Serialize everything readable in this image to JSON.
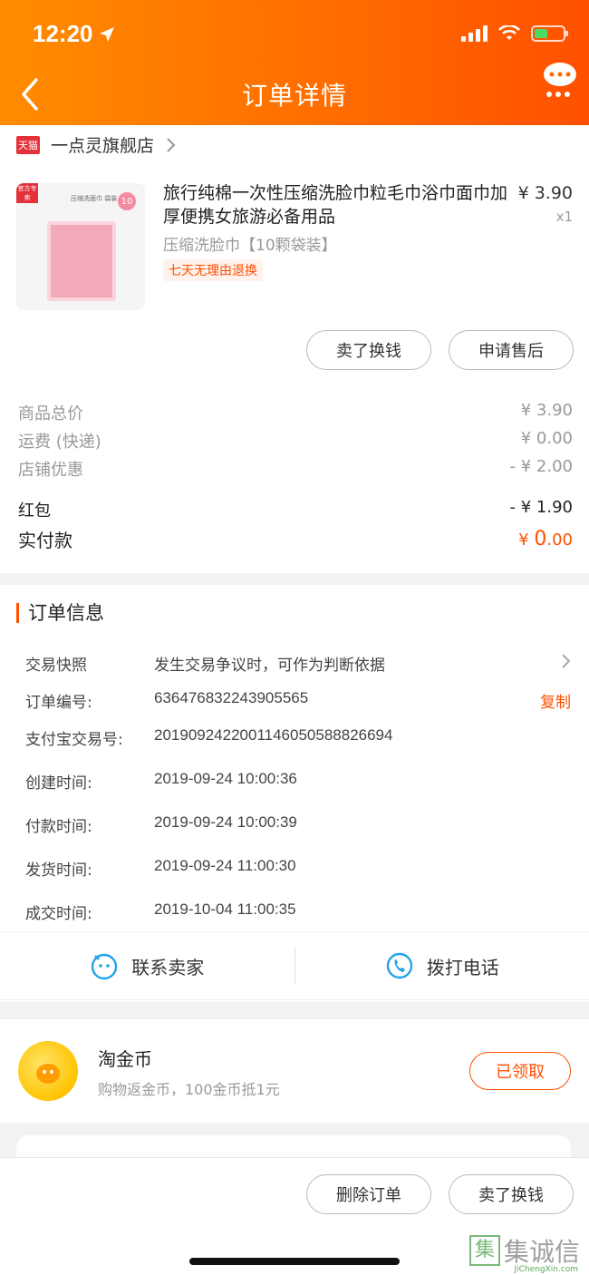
{
  "status_bar": {
    "time": "12:20"
  },
  "nav": {
    "title": "订单详情"
  },
  "store": {
    "badge": "天猫",
    "name": "一点灵旗舰店"
  },
  "product": {
    "image_badge": "官方专卖",
    "image_label": "压缩洗面巾 袋装",
    "image_count": "10",
    "title": "旅行纯棉一次性压缩洗脸巾粒毛巾浴巾面巾加厚便携女旅游必备用品",
    "price": "¥ 3.90",
    "qty": "x1",
    "spec": "压缩洗脸巾【10颗袋装】",
    "return_tag": "七天无理由退换"
  },
  "item_actions": {
    "sell": "卖了换钱",
    "after_sale": "申请售后"
  },
  "fees": {
    "goods_total_label": "商品总价",
    "goods_total": "¥ 3.90",
    "shipping_label": "运费 (快递)",
    "shipping": "¥ 0.00",
    "shop_discount_label": "店铺优惠",
    "shop_discount": "- ¥ 2.00",
    "red_packet_label": "红包",
    "red_packet": "- ¥ 1.90",
    "paid_label": "实付款",
    "paid_symbol": "¥ ",
    "paid_int": "0",
    "paid_dec": ".00"
  },
  "order_info": {
    "title": "订单信息",
    "snapshot_label": "交易快照",
    "snapshot_value": "发生交易争议时，可作为判断依据",
    "order_no_label": "订单编号:",
    "order_no": "636476832243905565",
    "copy": "复制",
    "alipay_label": "支付宝交易号:",
    "alipay_no": "2019092422001146050588826694",
    "created_label": "创建时间:",
    "created": "2019-09-24 10:00:36",
    "paid_label": "付款时间:",
    "paid": "2019-09-24 10:00:39",
    "shipped_label": "发货时间:",
    "shipped": "2019-09-24 11:00:30",
    "done_label": "成交时间:",
    "done": "2019-10-04 11:00:35"
  },
  "contact": {
    "seller": "联系卖家",
    "call": "拨打电话"
  },
  "coins": {
    "title": "淘金币",
    "subtitle": "购物返金币，100金币抵1元",
    "button": "已领取"
  },
  "bottom": {
    "delete": "删除订单",
    "sell": "卖了换钱"
  },
  "watermark": {
    "text": "集诚信",
    "sub": "JiChengXin.com"
  },
  "colors": {
    "accent": "#ff5000",
    "header_start": "#ff8c00",
    "header_end": "#ff5000"
  }
}
